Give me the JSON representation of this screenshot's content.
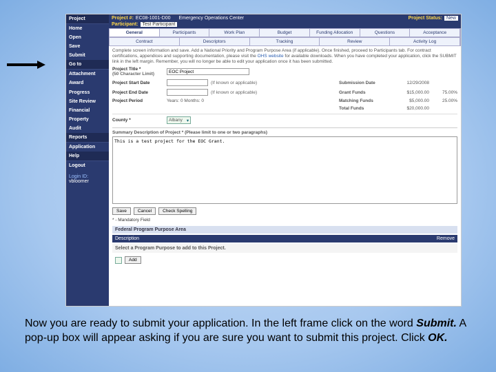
{
  "header": {
    "project_num_label": "Project #:",
    "project_num": "EC08-1001-D00",
    "project_name": "Emergency Operations Center",
    "status_label": "Project Status:",
    "status": "New",
    "participant_label": "Participant:",
    "participant": "Test Participant"
  },
  "leftnav": {
    "s1": "Project",
    "items1": [
      "Home",
      "Open",
      "Save",
      "Submit"
    ],
    "s2": "Go to",
    "items2": [
      "Attachment",
      "Award",
      "Progress",
      "Site Review",
      "Financial",
      "Property",
      "Audit"
    ],
    "s3": "Reports",
    "items3": [
      "Application"
    ],
    "s4": "Help",
    "items4": [
      "Logout"
    ],
    "login_label": "Login ID:",
    "login_id": "vbloomer"
  },
  "tabs_row1": [
    "General",
    "Participants",
    "Work Plan",
    "Budget",
    "Funding Allocation",
    "Questions",
    "Acceptance"
  ],
  "tabs_row2": [
    "Contract",
    "Descriptors",
    "Tracking",
    "Review",
    "Activity Log"
  ],
  "instructions": "Complete screen information and save. Add a National Priority and Program Purpose Area (if applicable). Once finished, proceed to Participants tab. For contract certifications, appendices and supporting documentation, please visit the ",
  "instructions_link": "OHS website",
  "instructions2": " for available downloads. When you have completed your application, click the SUBMIT link in the left margin. Remember, you will no longer be able to edit your application once it has been submitted.",
  "fields": {
    "title_label": "Project Title *",
    "title_hint": "(50 Character Limit)",
    "title_value": "EOC Project",
    "start_label": "Project Start Date",
    "start_hint": "(If known or applicable)",
    "end_label": "Project End Date",
    "end_hint": "(If known or applicable)",
    "period_label": "Project Period",
    "period_value": "Years: 0  Months: 0",
    "sub_date_label": "Submission Date",
    "sub_date": "12/29/2008",
    "grant_label": "Grant Funds",
    "grant_value": "$15,000.00",
    "grant_pct": "75.00%",
    "match_label": "Matching Funds",
    "match_value": "$5,000.00",
    "match_pct": "25.00%",
    "total_label": "Total Funds",
    "total_value": "$20,000.00",
    "county_label": "County *",
    "county_value": "Albany",
    "summary_label": "Summary Description of Project * (Please limit to one or two paragraphs)",
    "summary_value": "This is a test project for the EOC Grant."
  },
  "buttons": {
    "save": "Save",
    "cancel": "Cancel",
    "spell": "Check Spelling"
  },
  "mandatory": "* - Mandatory Field",
  "fppa": "Federal Program Purpose Area",
  "desc_hdr": {
    "c1": "Description",
    "c2": "Remove"
  },
  "addrow": {
    "label": "Select a Program Purpose to add to this Project.",
    "btn": "Add"
  },
  "caption": {
    "t1": "Now you are ready to submit your application. In the left frame click on the word ",
    "b1": "Submit.",
    "t2": "  A pop-up box will appear asking if you are sure you want to submit this project.  Click ",
    "b2": "OK.",
    "t3": ""
  }
}
